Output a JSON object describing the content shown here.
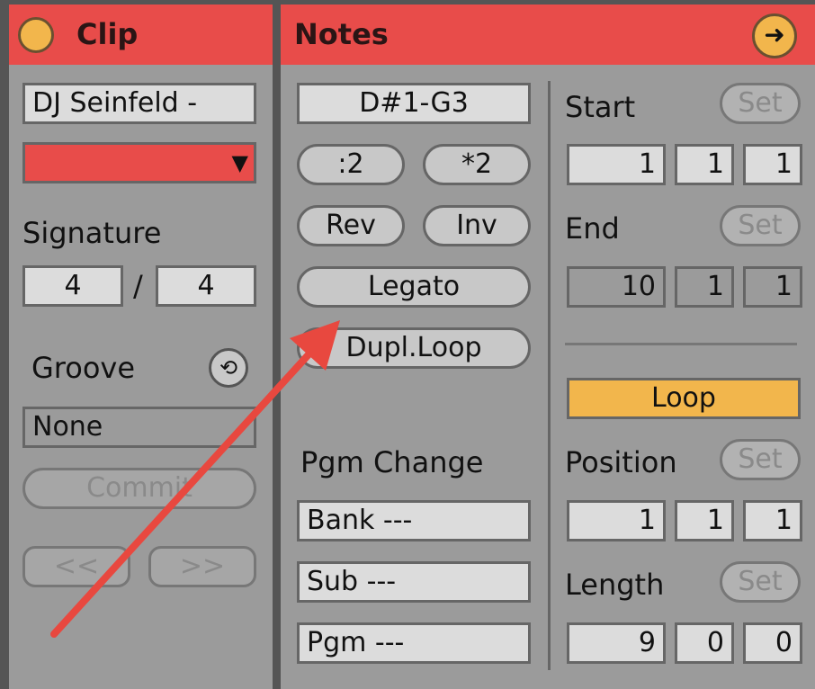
{
  "clip": {
    "title": "Clip",
    "name": "DJ Seinfeld -",
    "signature_label": "Signature",
    "sig_num": "4",
    "sig_sep": "/",
    "sig_den": "4",
    "groove_label": "Groove",
    "groove_value": "None",
    "commit": "Commit",
    "prev": "<<",
    "next": ">>",
    "clip_color": "#e84c4a"
  },
  "notes": {
    "title": "Notes",
    "range": "D#1-G3",
    "half": ":2",
    "double": "*2",
    "rev": "Rev",
    "inv": "Inv",
    "legato": "Legato",
    "dupl": "Dupl.Loop",
    "pgm_label": "Pgm Change",
    "bank": "Bank ---",
    "sub": "Sub ---",
    "pgm": "Pgm ---"
  },
  "markers": {
    "start_label": "Start",
    "set": "Set",
    "start": [
      "1",
      "1",
      "1"
    ],
    "end_label": "End",
    "end": [
      "10",
      "1",
      "1"
    ],
    "loop": "Loop",
    "position_label": "Position",
    "position": [
      "1",
      "1",
      "1"
    ],
    "length_label": "Length",
    "length": [
      "9",
      "0",
      "0"
    ]
  },
  "colors": {
    "header": "#e84c4a",
    "accent": "#f2b64c",
    "arrow": "#e8483f"
  }
}
